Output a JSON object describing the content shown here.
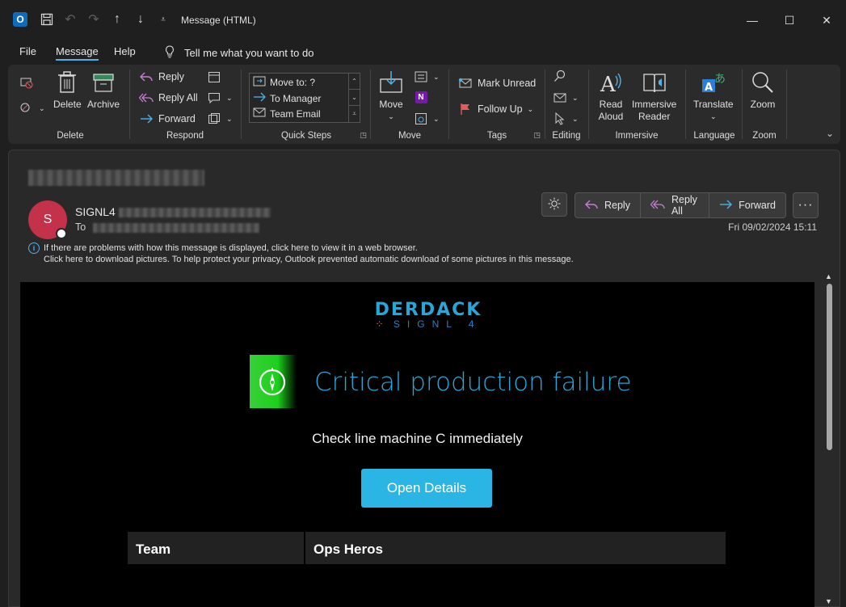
{
  "window": {
    "title": "Message (HTML)",
    "app_logo_letter": "O"
  },
  "menu": {
    "file": "File",
    "message": "Message",
    "help": "Help",
    "tell_me": "Tell me what you want to do"
  },
  "ribbon": {
    "delete_group": {
      "label": "Delete",
      "delete": "Delete",
      "archive": "Archive"
    },
    "respond_group": {
      "label": "Respond",
      "reply": "Reply",
      "reply_all": "Reply All",
      "forward": "Forward"
    },
    "quick_steps_group": {
      "label": "Quick Steps",
      "items": [
        "Move to: ?",
        "To Manager",
        "Team Email"
      ]
    },
    "move_group": {
      "label": "Move",
      "move": "Move"
    },
    "tags_group": {
      "label": "Tags",
      "mark_unread": "Mark Unread",
      "follow_up": "Follow Up"
    },
    "editing_group": {
      "label": "Editing"
    },
    "immersive_group": {
      "label": "Immersive",
      "read_aloud_1": "Read",
      "read_aloud_2": "Aloud",
      "immersive_reader_1": "Immersive",
      "immersive_reader_2": "Reader"
    },
    "language_group": {
      "label": "Language",
      "translate": "Translate"
    },
    "zoom_group": {
      "label": "Zoom",
      "zoom": "Zoom"
    }
  },
  "message": {
    "avatar_letter": "S",
    "sender": "SIGNL4",
    "to_label": "To",
    "date": "Fri 09/02/2024 15:11",
    "actions": {
      "reply": "Reply",
      "reply_all": "Reply All",
      "forward": "Forward"
    },
    "info_line_1": "If there are problems with how this message is displayed, click here to view it in a web browser.",
    "info_line_2": "Click here to download pictures. To help protect your privacy, Outlook prevented automatic download of some pictures in this message."
  },
  "email": {
    "brand_name": "DERDACK",
    "brand_sub": "SIGNL 4",
    "alert_title": "Critical production failure",
    "alert_message": "Check line machine C immediately",
    "cta": "Open Details",
    "table": [
      {
        "key": "Team",
        "value": "Ops Heros"
      }
    ]
  },
  "colors": {
    "accent": "#4fb1e9",
    "brand_blue": "#2aa6d6",
    "cta": "#2ab5e4",
    "avatar": "#c4314b"
  }
}
